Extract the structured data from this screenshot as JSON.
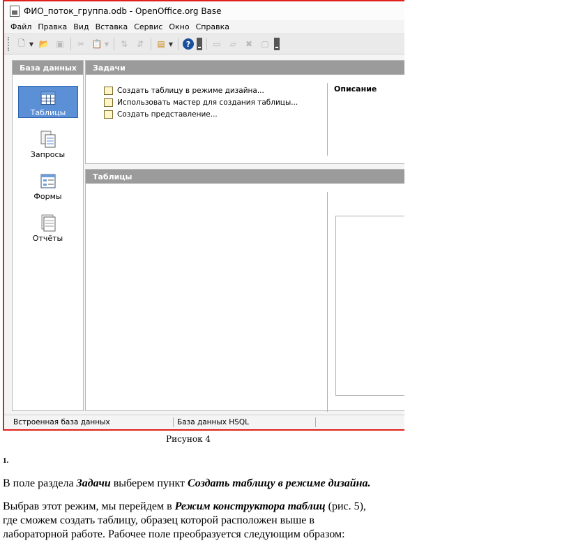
{
  "window": {
    "title": "ФИО_поток_группа.odb - OpenOffice.org Base",
    "menu": [
      "Файл",
      "Правка",
      "Вид",
      "Вставка",
      "Сервис",
      "Окно",
      "Справка"
    ],
    "toolbar_icons": [
      "new-document-icon",
      "open-folder-icon",
      "save-icon",
      "cut-icon",
      "paste-icon",
      "sort-ascending-icon",
      "sort-descending-icon",
      "form-icon",
      "help-icon",
      "table-icon",
      "query-icon",
      "delete-icon",
      "rename-icon"
    ]
  },
  "sidebar": {
    "header": "База данных",
    "items": [
      {
        "label": "Таблицы",
        "icon": "tables-icon",
        "selected": true
      },
      {
        "label": "Запросы",
        "icon": "queries-icon",
        "selected": false
      },
      {
        "label": "Формы",
        "icon": "forms-icon",
        "selected": false
      },
      {
        "label": "Отчёты",
        "icon": "reports-icon",
        "selected": false
      }
    ]
  },
  "tasks": {
    "header": "Задачи",
    "items": [
      "Создать таблицу в режиме дизайна...",
      "Использовать мастер для создания таблицы...",
      "Создать представление..."
    ],
    "description_header": "Описание"
  },
  "tables_panel": {
    "header": "Таблицы"
  },
  "statusbar": {
    "left": "Встроенная база данных",
    "right": "База данных HSQL"
  },
  "document": {
    "caption": "Рисунок 4",
    "number": "1.",
    "para1": {
      "t1": "В поле раздела ",
      "b1": "Задачи",
      "t2": " выберем пункт ",
      "b2": "Создать таблицу в режиме дизайна."
    },
    "para2": {
      "t1": "Выбрав этот режим, мы перейдем в ",
      "b1": "Режим конструктора таблиц",
      "t2": " (рис. 5),",
      "line2": "где сможем создать таблицу, образец которой расположен выше в",
      "line3": "лабораторной работе. Рабочее поле преобразуется следующим  образом:"
    }
  },
  "colors": {
    "window_border": "#e0201a",
    "panel_header": "#9b9b9b",
    "selection": "#5b8fd6"
  }
}
